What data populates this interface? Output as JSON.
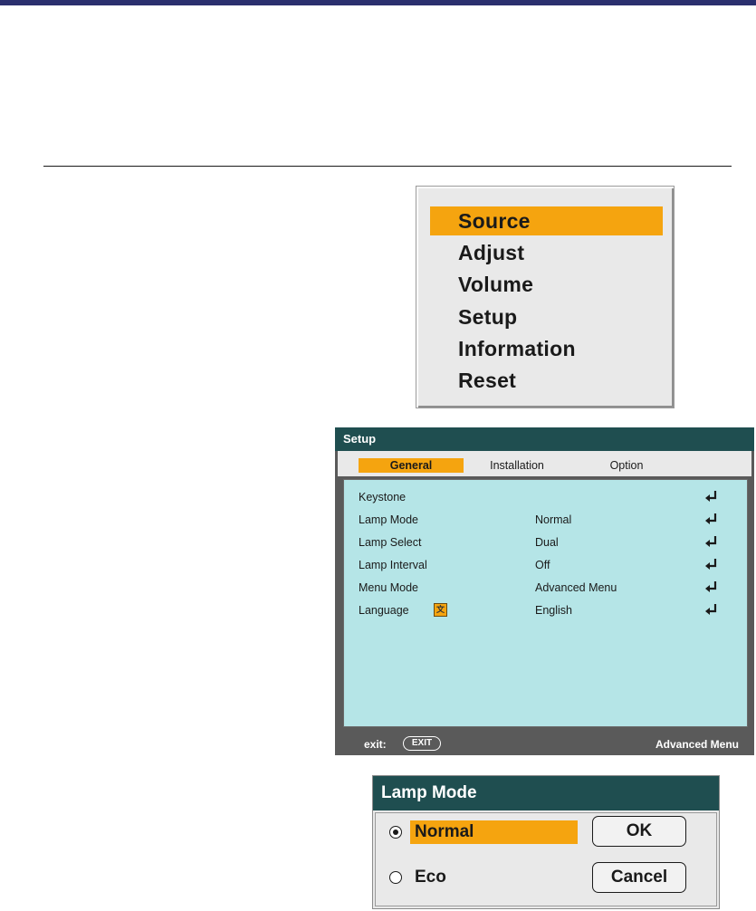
{
  "main_menu": {
    "items": [
      {
        "label": "Source",
        "selected": true
      },
      {
        "label": "Adjust",
        "selected": false
      },
      {
        "label": "Volume",
        "selected": false
      },
      {
        "label": "Setup",
        "selected": false
      },
      {
        "label": "Information",
        "selected": false
      },
      {
        "label": "Reset",
        "selected": false
      }
    ]
  },
  "setup_window": {
    "title": "Setup",
    "tabs": [
      {
        "label": "General",
        "selected": true
      },
      {
        "label": "Installation",
        "selected": false
      },
      {
        "label": "Option",
        "selected": false
      }
    ],
    "rows": [
      {
        "label": "Keystone",
        "value": ""
      },
      {
        "label": "Lamp Mode",
        "value": "Normal"
      },
      {
        "label": "Lamp Select",
        "value": "Dual"
      },
      {
        "label": "Lamp Interval",
        "value": "Off"
      },
      {
        "label": "Menu Mode",
        "value": "Advanced Menu"
      },
      {
        "label": "Language",
        "value": "English"
      }
    ],
    "footer": {
      "exit_label": "exit:",
      "exit_button": "EXIT",
      "mode": "Advanced Menu"
    }
  },
  "lamp_dialog": {
    "title": "Lamp Mode",
    "options": [
      {
        "label": "Normal",
        "checked": true
      },
      {
        "label": "Eco",
        "checked": false
      }
    ],
    "ok_label": "OK",
    "cancel_label": "Cancel"
  },
  "colors": {
    "accent": "#f5a40f",
    "title_bar": "#1f4e50",
    "setup_background": "#b5e5e7",
    "top_bar": "#2b2f6e"
  },
  "icons": {
    "enter": "enter-arrow-icon",
    "language": "language-icon"
  }
}
